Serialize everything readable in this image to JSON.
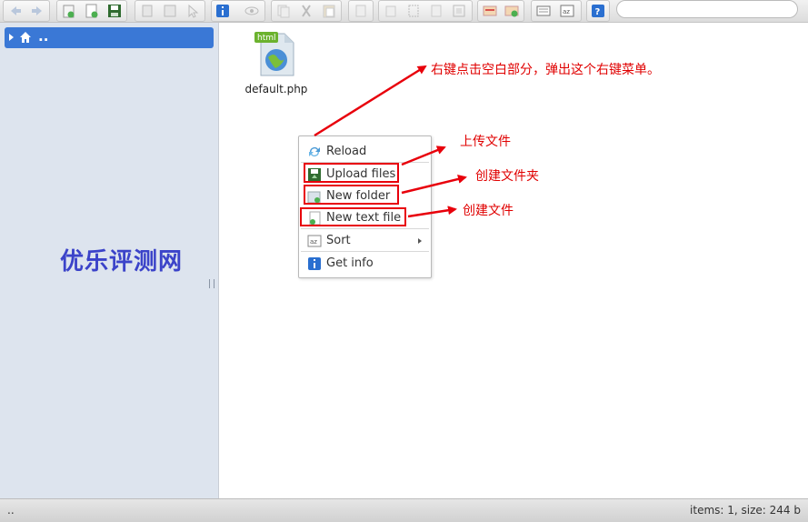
{
  "toolbar": {
    "buttons": [
      {
        "name": "back-icon"
      },
      {
        "name": "forward-icon"
      },
      {
        "name": "new-folder-icon"
      },
      {
        "name": "new-file-icon"
      },
      {
        "name": "save-icon"
      },
      {
        "name": "open-icon"
      },
      {
        "name": "download-icon"
      },
      {
        "name": "select-icon"
      },
      {
        "name": "info-icon"
      },
      {
        "name": "preview-icon"
      },
      {
        "name": "copy-icon"
      },
      {
        "name": "cut-icon"
      },
      {
        "name": "paste-icon"
      },
      {
        "name": "delete-icon"
      },
      {
        "name": "duplicate-icon"
      },
      {
        "name": "rename-icon"
      },
      {
        "name": "edit-icon"
      },
      {
        "name": "resize-icon"
      },
      {
        "name": "extract-icon"
      },
      {
        "name": "archive-icon"
      },
      {
        "name": "view-icon"
      },
      {
        "name": "sort-icon"
      },
      {
        "name": "help-icon"
      }
    ],
    "search_placeholder": ""
  },
  "sidebar": {
    "root_label": "..",
    "watermark": "优乐评测网"
  },
  "main": {
    "file": {
      "name": "default.php",
      "badge": "html"
    },
    "context_menu": {
      "items": [
        {
          "label": "Reload",
          "icon": "reload-icon"
        },
        {
          "label": "Upload files",
          "icon": "upload-icon"
        },
        {
          "label": "New folder",
          "icon": "new-folder-icon"
        },
        {
          "label": "New text file",
          "icon": "new-text-file-icon"
        },
        {
          "label": "Sort",
          "icon": "sort-icon",
          "submenu": true
        },
        {
          "label": "Get info",
          "icon": "info-icon"
        }
      ]
    },
    "annotations": {
      "right_click": "右键点击空白部分，弹出这个右键菜单。",
      "upload": "上传文件",
      "new_folder": "创建文件夹",
      "new_file": "创建文件"
    },
    "colors": {
      "annotation": "#e00000",
      "selection": "#3a78d6",
      "watermark": "#3b43c9"
    }
  },
  "statusbar": {
    "left": "..",
    "right": "items: 1, size: 244 b"
  }
}
